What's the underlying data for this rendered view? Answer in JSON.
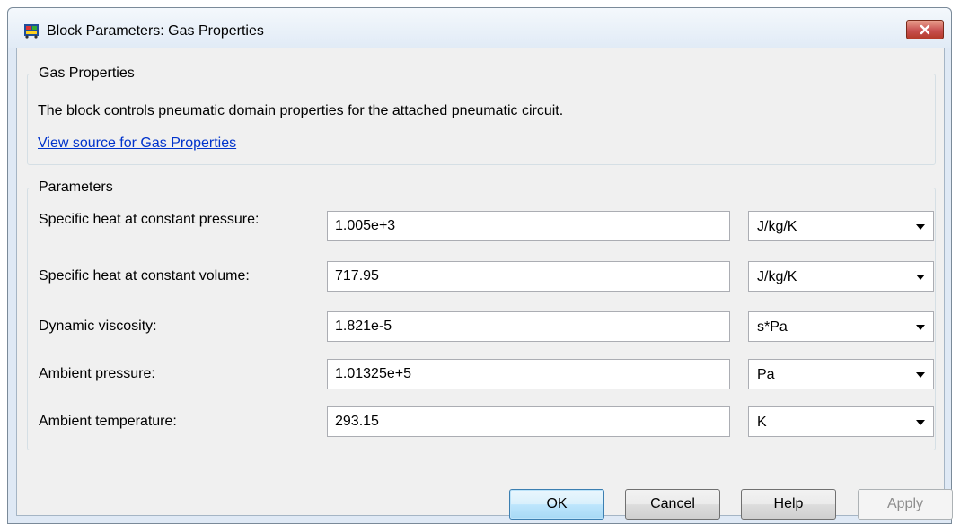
{
  "window": {
    "title": "Block Parameters: Gas Properties"
  },
  "gas_group": {
    "title": "Gas Properties",
    "description": "The block controls pneumatic domain properties for the attached pneumatic circuit.",
    "link": "View source for Gas Properties"
  },
  "params_group": {
    "title": "Parameters",
    "rows": [
      {
        "label": "Specific heat at constant pressure:",
        "value": "1.005e+3",
        "unit": "J/kg/K"
      },
      {
        "label": "Specific heat at constant volume:",
        "value": "717.95",
        "unit": "J/kg/K"
      },
      {
        "label": "Dynamic viscosity:",
        "value": "1.821e-5",
        "unit": "s*Pa"
      },
      {
        "label": "Ambient pressure:",
        "value": "1.01325e+5",
        "unit": "Pa"
      },
      {
        "label": "Ambient temperature:",
        "value": "293.15",
        "unit": "K"
      }
    ]
  },
  "buttons": {
    "ok": "OK",
    "cancel": "Cancel",
    "help": "Help",
    "apply": "Apply"
  },
  "colors": {
    "link": "#0033cc",
    "close_button": "#c75050",
    "ok_border": "#3c7fb1"
  }
}
